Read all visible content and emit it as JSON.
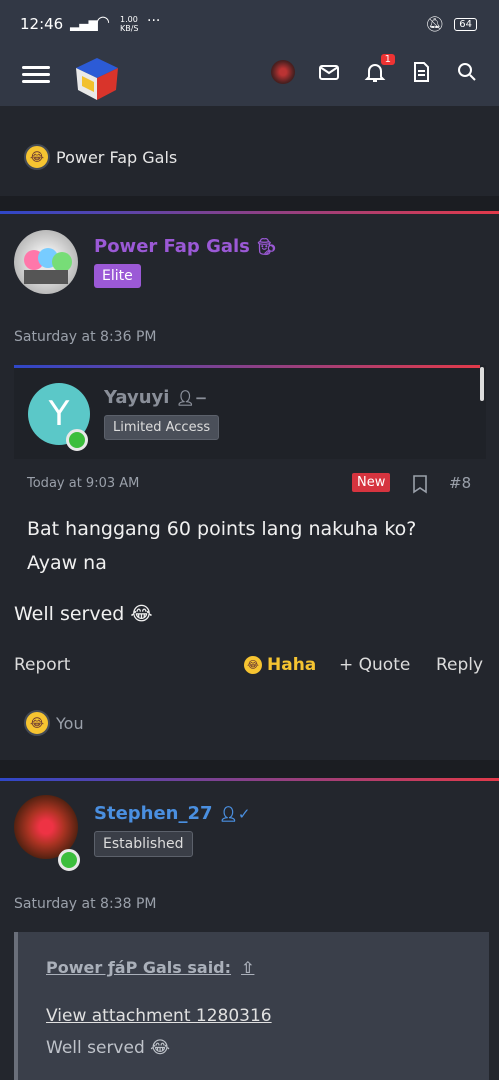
{
  "status": {
    "time": "12:46",
    "net_speed": "1.00\nKB/S",
    "dots": "···",
    "battery": "64"
  },
  "nav": {
    "notif_count": "1"
  },
  "top_reaction": {
    "label": "Power Fap Gals"
  },
  "post1": {
    "username": "Power Fap Gals",
    "role": "Elite",
    "time": "Saturday at 8:36 PM",
    "quote": {
      "username": "Yayuyi",
      "avatar_letter": "Y",
      "role": "Limited Access",
      "time": "Today at 9:03 AM",
      "new_badge": "New",
      "post_num": "#8",
      "text": "Bat hanggang 60 points lang nakuha ko? Ayaw na"
    },
    "text": "Well served 😂",
    "actions": {
      "report": "Report",
      "haha": "Haha",
      "quote": "+ Quote",
      "reply": "Reply"
    },
    "reaction_label": "You"
  },
  "post2": {
    "username": "Stephen_27",
    "role": "Established",
    "time": "Saturday at 8:38 PM",
    "quote_header": "Power ƒáP Gals said:",
    "attachment": "View attachment 1280316",
    "quote_text": "Well served 😂"
  },
  "colors": {
    "elite_purple": "#9b59d6",
    "stephen_blue": "#4a8fe0",
    "bg": "#1b1d22",
    "card": "#23262d"
  }
}
